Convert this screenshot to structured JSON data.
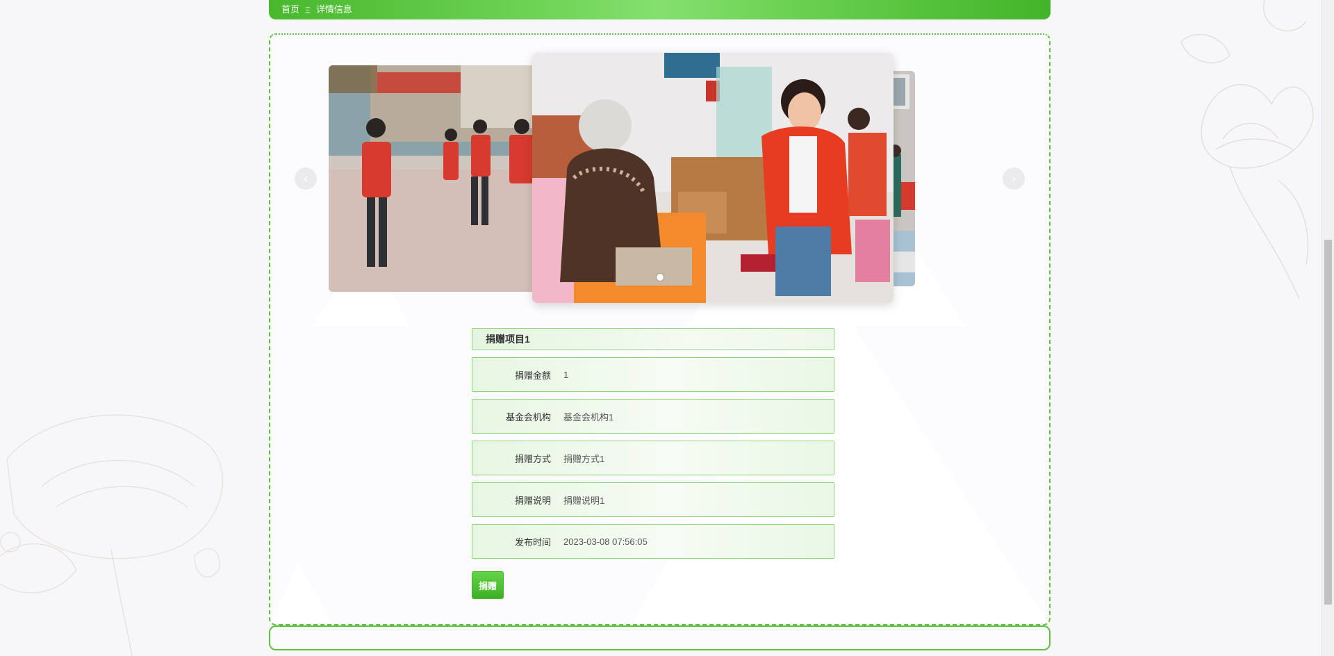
{
  "breadcrumb": {
    "home": "首页",
    "separator": "Ξ",
    "current": "详情信息"
  },
  "carousel": {
    "prev_icon": "chevron-left-icon",
    "next_icon": "chevron-right-icon",
    "slides": [
      "volunteers-street-photo",
      "elderly-visit-photo",
      "community-banner-photo"
    ],
    "active_index": 1,
    "dot_count": 1
  },
  "detail": {
    "title": "捐赠项目1",
    "fields": [
      {
        "label": "捐赠金额",
        "value": "1"
      },
      {
        "label": "基金会机构",
        "value": "基金会机构1"
      },
      {
        "label": "捐赠方式",
        "value": "捐赠方式1"
      },
      {
        "label": "捐赠说明",
        "value": "捐赠说明1"
      },
      {
        "label": "发布时间",
        "value": "2023-03-08 07:56:05"
      }
    ],
    "donate_button": "捐赠"
  },
  "colors": {
    "accent": "#4cbb30",
    "border": "#8fd47b",
    "row_bg": "#eef8ea"
  }
}
